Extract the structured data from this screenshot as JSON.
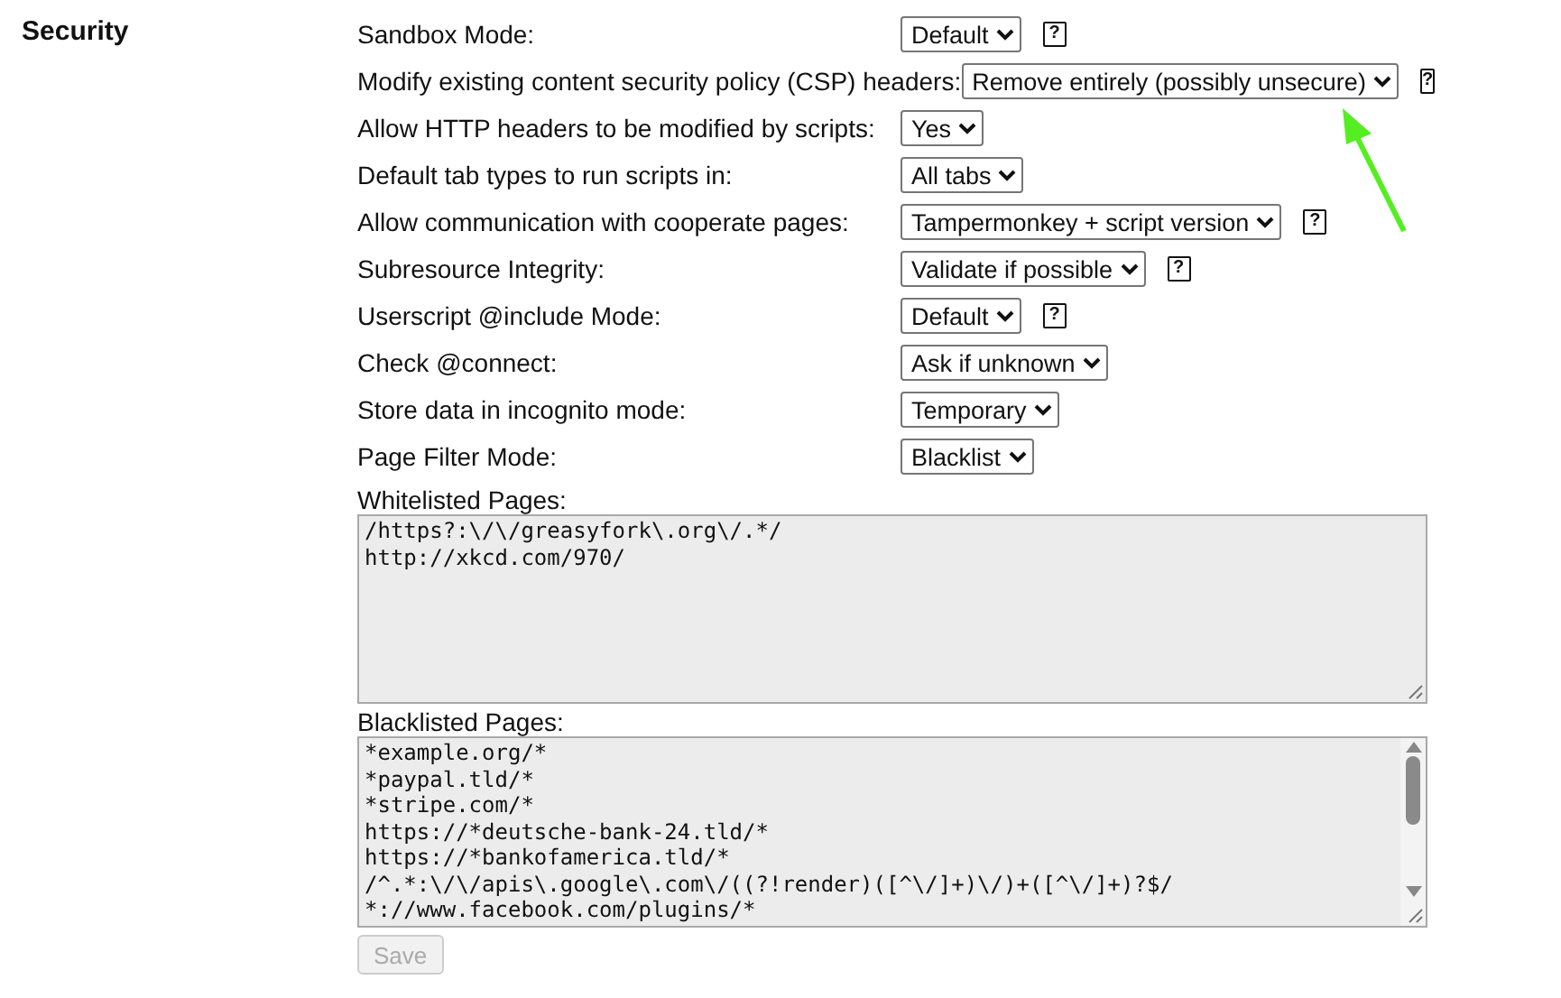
{
  "section": {
    "title": "Security"
  },
  "settings": [
    {
      "label": "Sandbox Mode:",
      "value": "Default",
      "help": "?"
    },
    {
      "label": "Modify existing content security policy (CSP) headers:",
      "value": "Remove entirely (possibly unsecure)",
      "help": "?"
    },
    {
      "label": "Allow HTTP headers to be modified by scripts:",
      "value": "Yes"
    },
    {
      "label": "Default tab types to run scripts in:",
      "value": "All tabs"
    },
    {
      "label": "Allow communication with cooperate pages:",
      "value": "Tampermonkey + script version",
      "help": "?"
    },
    {
      "label": "Subresource Integrity:",
      "value": "Validate if possible",
      "help": "?"
    },
    {
      "label": "Userscript @include Mode:",
      "value": "Default",
      "help": "?"
    },
    {
      "label": "Check @connect:",
      "value": "Ask if unknown"
    },
    {
      "label": "Store data in incognito mode:",
      "value": "Temporary"
    },
    {
      "label": "Page Filter Mode:",
      "value": "Blacklist"
    }
  ],
  "whitelist": {
    "label": "Whitelisted Pages:",
    "lines": [
      "/https?:\\/\\/greasyfork\\.org\\/.*/",
      "http://xkcd.com/970/"
    ]
  },
  "blacklist": {
    "label": "Blacklisted Pages:",
    "lines": [
      "*example.org/*",
      "*paypal.tld/*",
      "*stripe.com/*",
      "https://*deutsche-bank-24.tld/*",
      "https://*bankofamerica.tld/*",
      "/^.*:\\/\\/apis\\.google\\.com\\/((?!render)([^\\/]+)\\/)+([^\\/]+)?$/",
      "*://www.facebook.com/plugins/*"
    ]
  },
  "save_button": {
    "label": "Save",
    "disabled": true
  }
}
